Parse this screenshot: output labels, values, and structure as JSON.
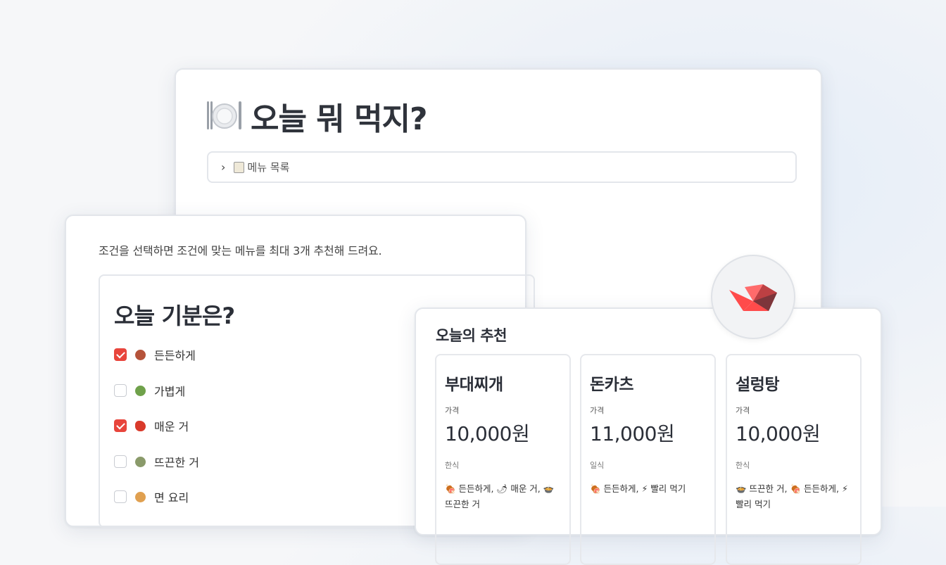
{
  "main": {
    "title": "오늘 뭐 먹지?",
    "plate_icon": "plate-icon",
    "expander_label": "메뉴 목록",
    "expander_icon": "chevron-right-icon",
    "note_icon": "notebook-icon"
  },
  "filter": {
    "intro": "조건을 선택하면 조건에 맞는 메뉴를 최대 3개 추천해 드려요.",
    "mood_title": "오늘 기분은?",
    "options": [
      {
        "label": "든든하게",
        "checked": true,
        "icon": "meat-icon"
      },
      {
        "label": "가볍게",
        "checked": false,
        "icon": "salad-icon"
      },
      {
        "label": "매운 거",
        "checked": true,
        "icon": "chili-icon"
      },
      {
        "label": "뜨끈한 거",
        "checked": false,
        "icon": "stew-icon"
      },
      {
        "label": "면 요리",
        "checked": false,
        "icon": "noodle-icon"
      }
    ],
    "accent": "#e8453c"
  },
  "recommend": {
    "title": "오늘의 추천",
    "price_label": "가격",
    "cards": [
      {
        "name": "부대찌개",
        "price": "10,000원",
        "category": "한식",
        "tags": "🍖 든든하게, 🌶 매운 거, 🍲 뜨끈한 거"
      },
      {
        "name": "돈카츠",
        "price": "11,000원",
        "category": "일식",
        "tags": "🍖 든든하게, ⚡ 빨리 먹기"
      },
      {
        "name": "설렁탕",
        "price": "10,000원",
        "category": "한식",
        "tags": "🍲 뜨끈한 거, 🍖 든든하게, ⚡ 빨리 먹기"
      }
    ]
  },
  "logo": {
    "icon": "streamlit-logo-icon",
    "colors": [
      "#ff4b4b",
      "#bd4043",
      "#7d353b"
    ]
  }
}
